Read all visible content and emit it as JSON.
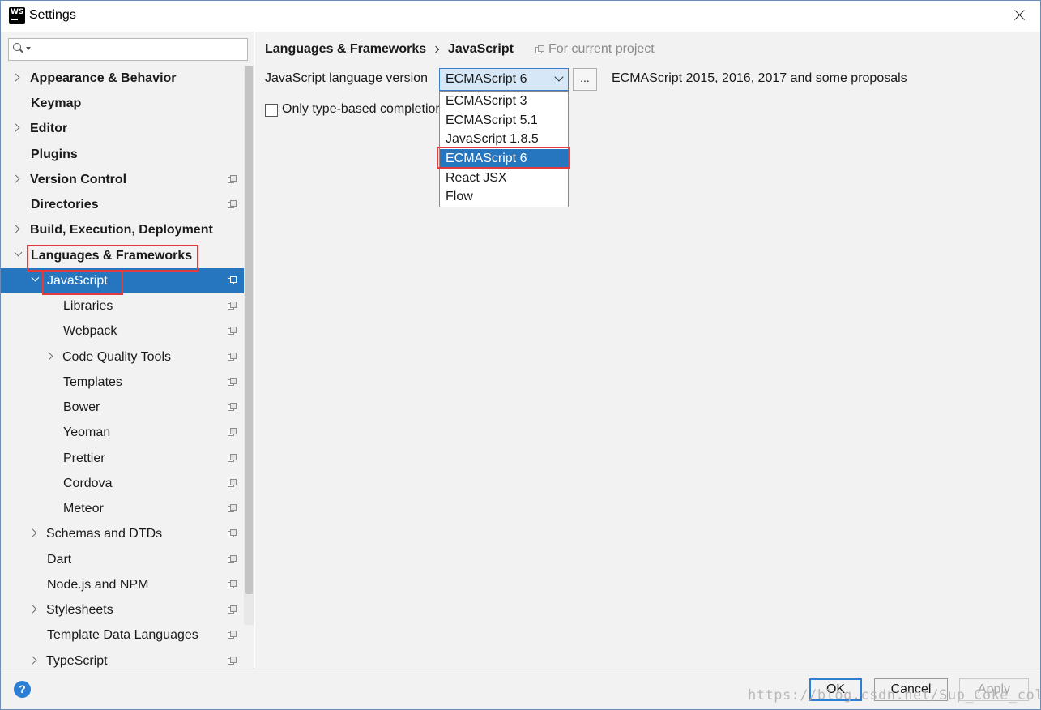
{
  "window": {
    "title": "Settings",
    "app_icon": "webstorm-icon"
  },
  "search": {
    "placeholder": ""
  },
  "tree": {
    "appearance": "Appearance & Behavior",
    "keymap": "Keymap",
    "editor": "Editor",
    "plugins": "Plugins",
    "version_control": "Version Control",
    "directories": "Directories",
    "build": "Build, Execution, Deployment",
    "languages": "Languages & Frameworks",
    "javascript": "JavaScript",
    "libraries": "Libraries",
    "webpack": "Webpack",
    "code_quality": "Code Quality Tools",
    "templates": "Templates",
    "bower": "Bower",
    "yeoman": "Yeoman",
    "prettier": "Prettier",
    "cordova": "Cordova",
    "meteor": "Meteor",
    "schemas": "Schemas and DTDs",
    "dart": "Dart",
    "nodejs": "Node.js and NPM",
    "stylesheets": "Stylesheets",
    "template_data": "Template Data Languages",
    "typescript": "TypeScript"
  },
  "content": {
    "breadcrumb_parent": "Languages & Frameworks",
    "breadcrumb_current": "JavaScript",
    "for_current_project": "For current project",
    "language_version_label": "JavaScript language version",
    "selected_version": "ECMAScript 6",
    "more_button": "...",
    "version_description": "ECMAScript 2015, 2016, 2017 and some proposals",
    "only_type_based": "Only type-based completion",
    "only_type_based_checked": false
  },
  "dropdown": {
    "options": [
      "ECMAScript 3",
      "ECMAScript 5.1",
      "JavaScript 1.8.5",
      "ECMAScript 6",
      "React JSX",
      "Flow"
    ],
    "selected_index": 3
  },
  "buttons": {
    "help": "?",
    "ok": "OK",
    "cancel": "Cancel",
    "apply": "Apply"
  },
  "watermark": "https://blog.csdn.net/Sup_Coke_cola",
  "colors": {
    "selection": "#2675bf",
    "highlight_box": "#e33b3b",
    "panel_bg": "#f2f2f2"
  }
}
